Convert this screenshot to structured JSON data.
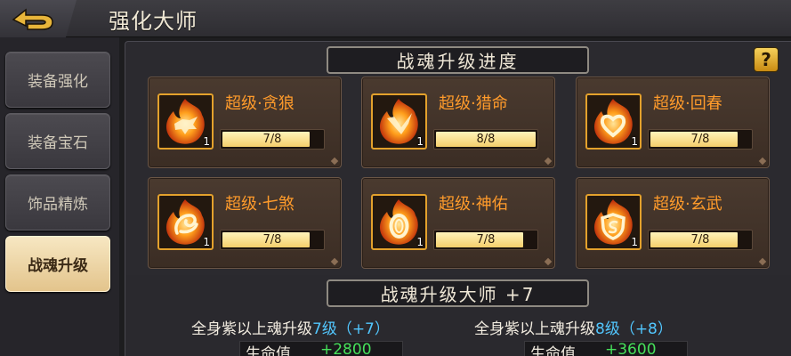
{
  "header": {
    "title": "强化大师",
    "back_icon": "return-arrow-icon"
  },
  "sidebar": {
    "items": [
      {
        "label": "装备强化",
        "active": false
      },
      {
        "label": "装备宝石",
        "active": false
      },
      {
        "label": "饰品精炼",
        "active": false
      },
      {
        "label": "战魂升级",
        "active": true
      }
    ]
  },
  "progress_section": {
    "title": "战魂升级进度",
    "help_label": "?",
    "cards": [
      {
        "name": "超级·贪狼",
        "progress": "7/8",
        "value": 7,
        "max": 8,
        "level": "1",
        "icon": "wolf-flame-icon"
      },
      {
        "name": "超级·猎命",
        "progress": "8/8",
        "value": 8,
        "max": 8,
        "level": "1",
        "icon": "slash-flame-icon"
      },
      {
        "name": "超级·回春",
        "progress": "7/8",
        "value": 7,
        "max": 8,
        "level": "1",
        "icon": "heart-flame-icon"
      },
      {
        "name": "超级·七煞",
        "progress": "7/8",
        "value": 7,
        "max": 8,
        "level": "1",
        "icon": "phoenix-flame-icon"
      },
      {
        "name": "超级·神佑",
        "progress": "7/8",
        "value": 7,
        "max": 8,
        "level": "1",
        "icon": "ring-flame-icon"
      },
      {
        "name": "超级·玄武",
        "progress": "7/8",
        "value": 7,
        "max": 8,
        "level": "1",
        "icon": "shield-flame-icon"
      }
    ]
  },
  "master_section": {
    "title": "战魂升级大师 +7",
    "bonuses": [
      {
        "prefix": "全身紫以上魂升级",
        "highlight": "7级（+7）",
        "stat_name": "生命值",
        "stat_value": "+2800"
      },
      {
        "prefix": "全身紫以上魂升级",
        "highlight": "8级（+8）",
        "stat_name": "生命值",
        "stat_value": "+3600"
      }
    ]
  },
  "colors": {
    "card_name": "#ff9b2b",
    "highlight": "#52c7ff",
    "stat_value": "#46e05a",
    "icon_border": "#e3a12c"
  }
}
